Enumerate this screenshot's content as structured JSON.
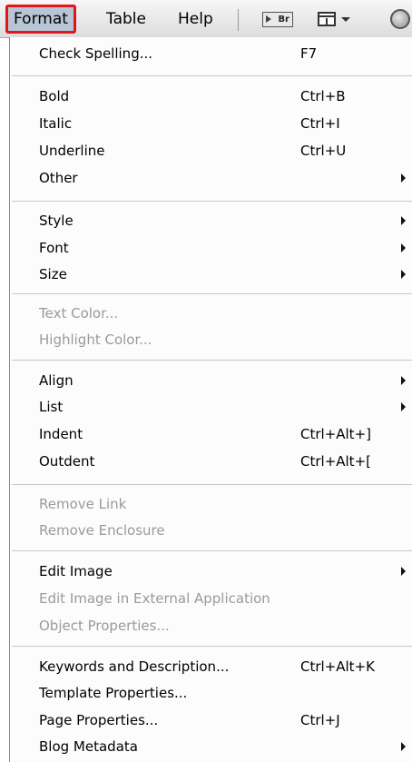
{
  "menubar": {
    "format": "Format",
    "table": "Table",
    "help": "Help",
    "toolbar_icons": [
      "bridge-icon",
      "layout-icon",
      "dropdown-arrow-icon",
      "globe-icon"
    ],
    "br_label": "Br"
  },
  "colors": {
    "highlight_border": "#e0161b",
    "active_menu_bg": "#b7c5d6",
    "disabled_text": "#9a9a9a"
  },
  "menu": {
    "check_spelling": {
      "label": "Check Spelling...",
      "shortcut": "F7"
    },
    "bold": {
      "label": "Bold",
      "shortcut": "Ctrl+B"
    },
    "italic": {
      "label": "Italic",
      "shortcut": "Ctrl+I"
    },
    "underline": {
      "label": "Underline",
      "shortcut": "Ctrl+U"
    },
    "other": {
      "label": "Other"
    },
    "style": {
      "label": "Style"
    },
    "font": {
      "label": "Font"
    },
    "size": {
      "label": "Size"
    },
    "text_color": {
      "label": "Text Color..."
    },
    "highlight_color": {
      "label": "Highlight Color..."
    },
    "align": {
      "label": "Align"
    },
    "list": {
      "label": "List"
    },
    "indent": {
      "label": "Indent",
      "shortcut": "Ctrl+Alt+]"
    },
    "outdent": {
      "label": "Outdent",
      "shortcut": "Ctrl+Alt+["
    },
    "remove_link": {
      "label": "Remove Link"
    },
    "remove_enclosure": {
      "label": "Remove Enclosure"
    },
    "edit_image": {
      "label": "Edit Image"
    },
    "edit_image_external": {
      "label": "Edit Image in External Application"
    },
    "object_properties": {
      "label": "Object Properties..."
    },
    "keywords": {
      "label": "Keywords and Description...",
      "shortcut": "Ctrl+Alt+K"
    },
    "template_properties": {
      "label": "Template Properties..."
    },
    "page_properties": {
      "label": "Page Properties...",
      "shortcut": "Ctrl+J"
    },
    "blog_metadata": {
      "label": "Blog Metadata"
    }
  }
}
